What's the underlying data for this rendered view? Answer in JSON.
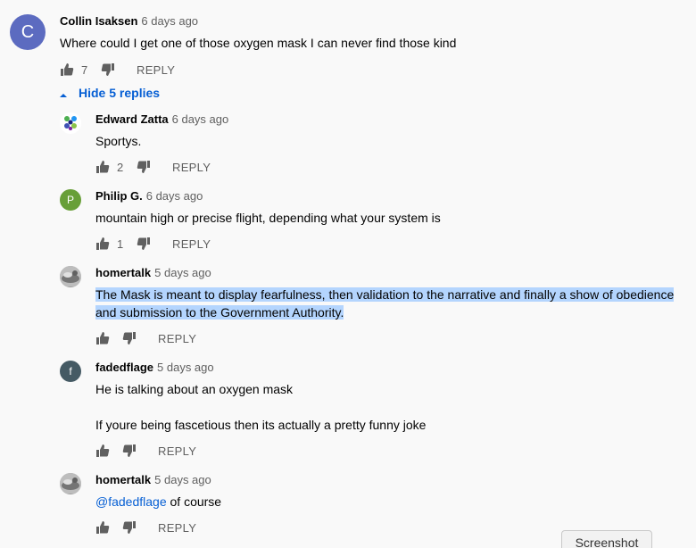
{
  "colors": {
    "accent": "#065fd4",
    "highlight": "#b4d5fe",
    "muted": "#606060",
    "avatar_collin": "#5c6bc0",
    "avatar_philip": "#689f38",
    "avatar_fadedflage": "#455a64"
  },
  "top_comment": {
    "avatar_letter": "C",
    "author": "Collin Isaksen",
    "time": "6 days ago",
    "text": "Where could I get one of those oxygen mask I can never find those kind",
    "likes": "7",
    "reply_label": "REPLY"
  },
  "replies_toggle": {
    "label": "Hide 5 replies",
    "icon": "caret-up-icon"
  },
  "replies": [
    {
      "avatar_icon": "cartoon-avatar-icon",
      "author": "Edward Zatta",
      "time": "6 days ago",
      "text": "Sportys.",
      "likes": "2",
      "reply_label": "REPLY"
    },
    {
      "avatar_letter": "P",
      "author": "Philip G.",
      "time": "6 days ago",
      "text": "mountain high or precise flight, depending what your system is",
      "likes": "1",
      "reply_label": "REPLY"
    },
    {
      "avatar_icon": "photo-avatar-icon",
      "author": "homertalk",
      "time": "5 days ago",
      "text_line1": "The Mask is meant to display fearfulness, then validation to the narrative and finally a show of obedience",
      "text_line2": "and submission to the Government Authority.",
      "likes": "",
      "reply_label": "REPLY"
    },
    {
      "avatar_letter": "f",
      "author": "fadedflage",
      "time": "5 days ago",
      "text_line1": "He is talking about an oxygen mask",
      "text_line2": "If youre being fascetious then its actually a pretty funny joke",
      "likes": "",
      "reply_label": "REPLY"
    },
    {
      "avatar_icon": "photo-avatar-icon",
      "author": "homertalk",
      "time": "5 days ago",
      "mention": "@fadedflage",
      "text_rest": " of course",
      "likes": "",
      "reply_label": "REPLY"
    }
  ],
  "overlay": {
    "screenshot_button": "Screenshot"
  }
}
